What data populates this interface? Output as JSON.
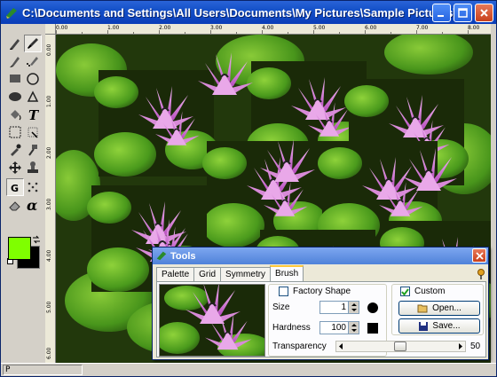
{
  "window": {
    "title": "C:\\Documents and Settings\\All Users\\Documents\\My Pictures\\Sample Pictures\\Water lilies.jp...",
    "app_icon": "paint-palette-icon",
    "controls": [
      "minimize-icon",
      "maximize-icon",
      "close-icon"
    ]
  },
  "rulers": {
    "top": [
      "0.00",
      "1.00",
      "2.00",
      "3.00",
      "4.00",
      "5.00",
      "6.00",
      "7.00",
      "8.00"
    ],
    "left": [
      "0.00",
      "1.00",
      "2.00",
      "3.00",
      "4.00",
      "5.00",
      "6.00"
    ]
  },
  "toolbox": {
    "tools": [
      "pencil-icon",
      "brush-icon",
      "pen-icon",
      "airbrush-icon",
      "rectangle-icon",
      "ellipse-icon",
      "rounded-rect-icon",
      "polygon-icon",
      "fill-bucket-icon",
      "text-icon",
      "lasso-icon",
      "magic-wand-icon",
      "eyedropper-icon",
      "hammer-icon",
      "move-icon",
      "stamp-icon",
      "grid-icon",
      "pattern-icon",
      "eraser-icon",
      "alpha-icon"
    ],
    "foreground_color": "#7fff00",
    "background_color": "#000000"
  },
  "status": {
    "text": "P"
  },
  "tools_panel": {
    "title": "Tools",
    "tabs": [
      "Palette",
      "Grid",
      "Symmetry",
      "Brush"
    ],
    "active_tab": "Brush",
    "factory_shape_label": "Factory Shape",
    "size_label": "Size",
    "size_value": "1",
    "hardness_label": "Hardness",
    "hardness_value": "100",
    "custom_label": "Custom",
    "custom_checked": true,
    "open_label": "Open...",
    "save_label": "Save...",
    "transparency_label": "Transparency",
    "transparency_value": "50",
    "transparency_fraction": 0.5
  }
}
